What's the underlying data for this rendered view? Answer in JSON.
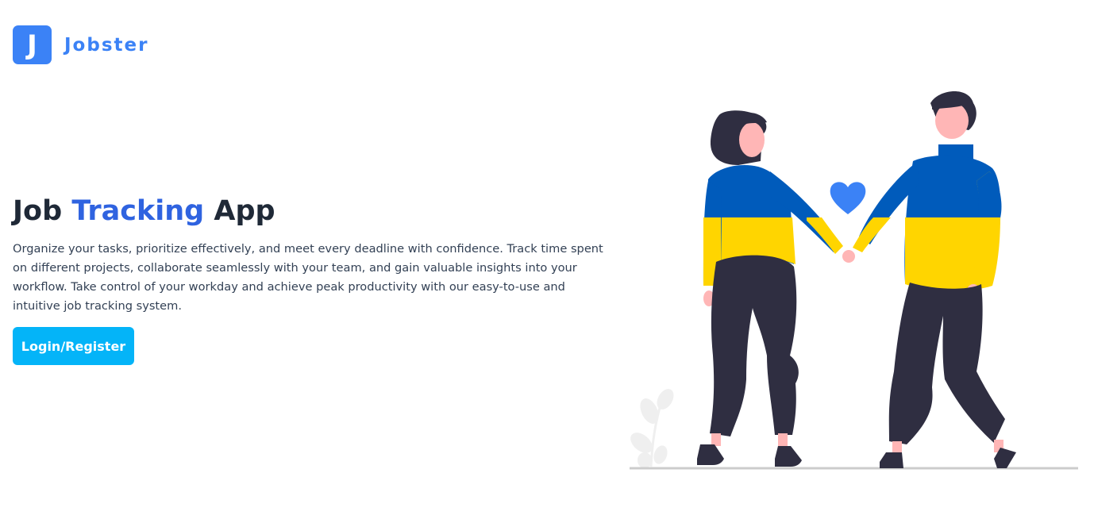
{
  "brand": {
    "logo_letter": "J",
    "name": "Jobster",
    "color": "#3b82f6"
  },
  "hero": {
    "title_part1": "Job ",
    "title_accent": "Tracking",
    "title_part2": " App",
    "accent_color": "#2f63e0",
    "description": "Organize your tasks, prioritize effectively, and meet every deadline with confidence. Track time spent on different projects, collaborate seamlessly with your team, and gain valuable insights into your workflow. Take control of your workday and achieve peak productivity with our easy-to-use and intuitive job tracking system.",
    "cta_label": "Login/Register",
    "cta_color": "#04b4f8"
  },
  "illustration": {
    "subject": "couple-holding-hands",
    "colors": {
      "sweater_top": "#005bbb",
      "sweater_bottom": "#ffd500",
      "pants": "#2f2e41",
      "skin": "#ffb6b6",
      "heart": "#3b82f6",
      "ground": "#cccccc"
    }
  }
}
